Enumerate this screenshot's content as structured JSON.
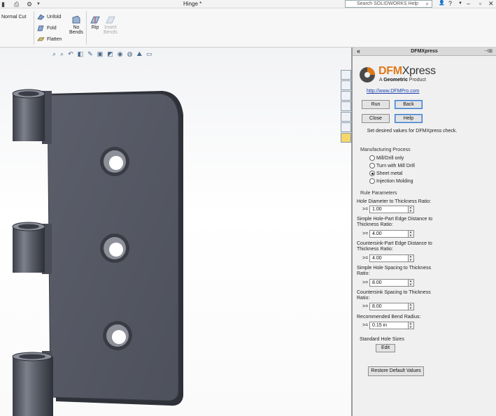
{
  "app": {
    "document_title": "Hinge *",
    "search_placeholder": "Search SOLIDWORKS Help"
  },
  "ribbon": {
    "normal_cut": "Normal Cut",
    "unfold": "Unfold",
    "fold": "Fold",
    "flatten": "Flatten",
    "no_bends": "No\nBends",
    "rip": "Rip",
    "insert_bends": "Insert\nBends"
  },
  "panel": {
    "title": "DFMXpress",
    "logo_dfm": "DFM",
    "logo_xpress": "Xpress",
    "logo_sub_prefix": "A ",
    "logo_sub_brand": "Geometric",
    "logo_sub_suffix": " Product",
    "link": "http://www.DFMPro.com",
    "buttons": {
      "run": "Run",
      "back": "Back",
      "close": "Close",
      "help": "Help",
      "edit": "Edit",
      "restore": "Restore Default Values"
    },
    "instruction": "Set desired values for DFMXpress check.",
    "manufacturing_process_label": "Manufacturing Process",
    "processes": [
      {
        "label": "Mill/Drill only",
        "selected": false
      },
      {
        "label": "Turn with Mill Drill",
        "selected": false
      },
      {
        "label": "Sheet metal",
        "selected": true
      },
      {
        "label": "Injection Molding",
        "selected": false
      }
    ],
    "rule_parameters_label": "Rule Parameters",
    "parameters": [
      {
        "label": "Hole Diameter to Thickness Ratio:",
        "op": ">=",
        "value": "1.00"
      },
      {
        "label": "Simple Hole-Part Edge Distance to Thickness Ratio:",
        "op": ">=",
        "value": "4.00"
      },
      {
        "label": "Countersink-Part Edge Distance to Thickness Ratio:",
        "op": ">=",
        "value": "4.00"
      },
      {
        "label": "Simple Hole Spacing to Thickness Ratio:",
        "op": ">=",
        "value": "8.00"
      },
      {
        "label": "Countersink Spacing to Thickness Ratio:",
        "op": ">=",
        "value": "8.00"
      },
      {
        "label": "Recommended Bend Radius:",
        "op": ">=",
        "value": "0.15 in"
      }
    ],
    "hole_sizes_label": "Standard Hole Sizes"
  },
  "colors": {
    "accent_orange": "#e07818",
    "link_blue": "#1a3db0",
    "part_gray": "#5a5d68"
  }
}
